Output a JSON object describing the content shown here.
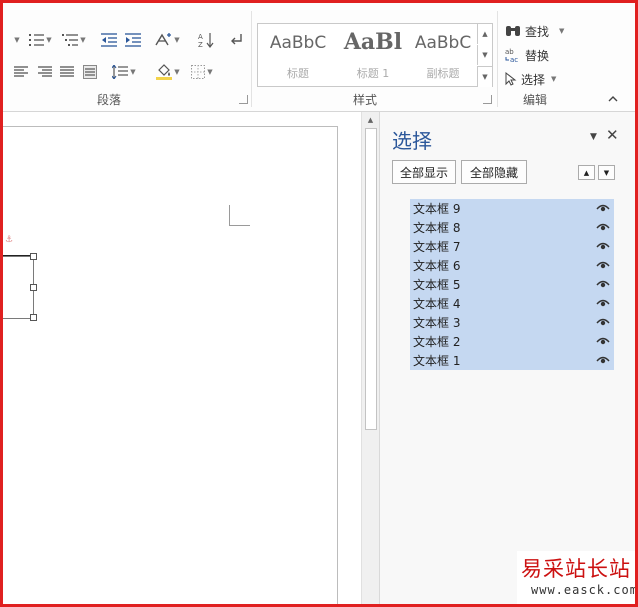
{
  "ribbon": {
    "groups": {
      "paragraph": "段落",
      "styles": "样式",
      "editing": "编辑"
    },
    "styles": [
      {
        "sample": "AaBbC",
        "label": "标题"
      },
      {
        "sample": "AaBl",
        "label": "标题 1"
      },
      {
        "sample": "AaBbC",
        "label": "副标题"
      }
    ],
    "editing": {
      "find": "查找",
      "replace": "替换",
      "select": "选择"
    }
  },
  "pane": {
    "title": "选择",
    "show_all": "全部显示",
    "hide_all": "全部隐藏",
    "items": [
      "文本框 9",
      "文本框 8",
      "文本框 7",
      "文本框 6",
      "文本框 5",
      "文本框 4",
      "文本框 3",
      "文本框 2",
      "文本框 1"
    ]
  },
  "watermark": {
    "title": "易采站长站",
    "url": "www.easck.com"
  },
  "colors": {
    "accent": "#2b579a",
    "selection": "#c5d8f1",
    "frame": "#e02020",
    "watermark": "#cc1111"
  }
}
